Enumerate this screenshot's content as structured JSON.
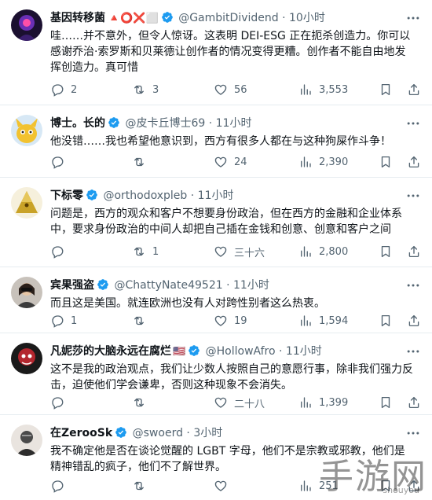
{
  "colors": {
    "verified": "#1d9bf0",
    "muted": "#536471",
    "text": "#0f1419",
    "divider": "#e6ecf0"
  },
  "tweets": [
    {
      "name": "基因转移菌",
      "name_emoji": "🔺⭕❌⬜",
      "handle": "@GambitDividend",
      "dot": "·",
      "time": "10小时",
      "text": "哇……并不意外，但令人惊讶。这表明 DEI-ESG 正在扼杀创造力。你可以感谢乔治·索罗斯和贝莱德让创作者的情况变得更糟。创作者不能自由地发挥创造力。真可惜",
      "replies": "2",
      "retweets": "3",
      "likes": "56",
      "views": "3,553"
    },
    {
      "name": "博士。长的",
      "handle": "@皮卡丘博士69",
      "dot": "·",
      "time": "11小时",
      "text": "他没错……我也希望他意识到，西方有很多人都在与这种狗屎作斗争！",
      "replies": "",
      "retweets": "",
      "likes": "24",
      "views": "2,390"
    },
    {
      "name": "下标零",
      "handle": "@orthodoxpleb",
      "dot": "·",
      "time": "11小时",
      "text": "问题是，西方的观众和客户不想要身份政治，但在西方的金融和企业体系中，要求身份政治的中间人却把自己插在金钱和创意、创意和客户之间",
      "replies": "",
      "retweets": "1",
      "likes": "三十六",
      "views": "2,800"
    },
    {
      "name": "宾果强盗",
      "handle": "@ChattyNate49521",
      "dot": "·",
      "time": "11小时",
      "text": "而且这是美国。就连欧洲也没有人对跨性别者这么热衷。",
      "replies": "1",
      "retweets": "",
      "likes": "19",
      "views": "1,594"
    },
    {
      "name": "凡妮莎的大脑永远在腐烂",
      "name_emoji": "🇺🇸",
      "handle": "@HollowAfro",
      "dot": "·",
      "time": "11小时",
      "text": "这不是我的政治观点，我们让少数人按照自己的意愿行事，除非我们强力反击，迫使他们学会谦卑，否则这种现象不会消失。",
      "replies": "",
      "retweets": "",
      "likes": "二十八",
      "views": "1,399"
    },
    {
      "name": "在ZerooSk",
      "handle": "@swoerd",
      "dot": "·",
      "time": "3小时",
      "text": "我不确定他是否在谈论觉醒的 LGBT 字母，他们不是宗教或邪教，他们是精神错乱的疯子，他们不了解世界。",
      "replies": "",
      "retweets": "",
      "likes": "",
      "views": "251"
    }
  ],
  "watermark": {
    "main": "手游网",
    "sub": "shouyou"
  },
  "icons": [
    "verified-badge-icon",
    "more-icon",
    "reply-icon",
    "retweet-icon",
    "like-icon",
    "views-icon",
    "bookmark-icon",
    "share-icon"
  ]
}
